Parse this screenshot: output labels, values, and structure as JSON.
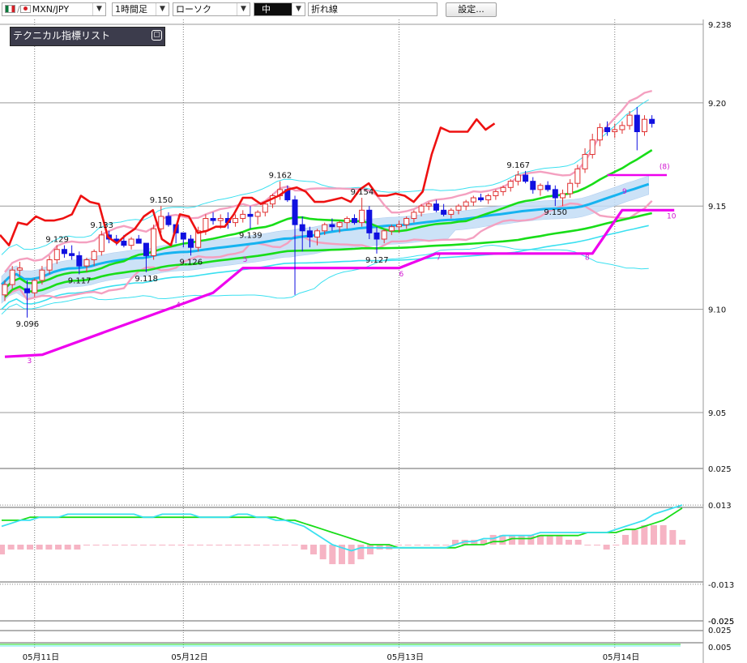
{
  "toolbar": {
    "pair": "MXN/JPY",
    "timeframe": "1時間足",
    "chart_type": "ローソク",
    "size": "中",
    "overlay": "折れ線",
    "settings_label": "設定..."
  },
  "legend": {
    "title": "テクニカル指標リスト",
    "minimize_glyph": "▢"
  },
  "colors": {
    "up_candle": "#e03030",
    "down_candle": "#1010e0",
    "red_line": "#ee1111",
    "pink_band": "#f4a0c0",
    "green_line": "#18dd18",
    "blue_line": "#16b3f0",
    "cloud": "#c4ddf6",
    "cyan_band": "#3ae0f0",
    "magenta_line": "#ee00ee",
    "macd_hist": "#f6b4c4"
  },
  "chart_data": [
    {
      "type": "candlestick",
      "x_labels": [
        "05月11日",
        "05月12日",
        "05月13日",
        "05月14日"
      ],
      "y_ticks": [
        "9.238",
        "9.20",
        "9.15",
        "9.10",
        "9.05"
      ],
      "ylim": [
        9.03,
        9.238
      ],
      "candles": [
        [
          9.107,
          9.114,
          9.104,
          9.112
        ],
        [
          9.112,
          9.121,
          9.11,
          9.119
        ],
        [
          9.119,
          9.123,
          9.116,
          9.12
        ],
        [
          9.11,
          9.114,
          9.096,
          9.108
        ],
        [
          9.108,
          9.115,
          9.106,
          9.114
        ],
        [
          9.114,
          9.121,
          9.112,
          9.119
        ],
        [
          9.119,
          9.126,
          9.117,
          9.124
        ],
        [
          9.124,
          9.131,
          9.122,
          9.129
        ],
        [
          9.129,
          9.131,
          9.125,
          9.127
        ],
        [
          9.127,
          9.131,
          9.124,
          9.126
        ],
        [
          9.126,
          9.128,
          9.117,
          9.121
        ],
        [
          9.121,
          9.125,
          9.118,
          9.124
        ],
        [
          9.124,
          9.129,
          9.121,
          9.128
        ],
        [
          9.128,
          9.138,
          9.126,
          9.136
        ],
        [
          9.136,
          9.138,
          9.132,
          9.134
        ],
        [
          9.134,
          9.136,
          9.131,
          9.133
        ],
        [
          9.133,
          9.136,
          9.13,
          9.131
        ],
        [
          9.131,
          9.135,
          9.129,
          9.134
        ],
        [
          9.134,
          9.136,
          9.132,
          9.132
        ],
        [
          9.132,
          9.132,
          9.118,
          9.126
        ],
        [
          9.126,
          9.141,
          9.124,
          9.139
        ],
        [
          9.139,
          9.15,
          9.137,
          9.145
        ],
        [
          9.145,
          9.147,
          9.14,
          9.141
        ],
        [
          9.141,
          9.141,
          9.132,
          9.137
        ],
        [
          9.137,
          9.137,
          9.13,
          9.134
        ],
        [
          9.134,
          9.136,
          9.126,
          9.13
        ],
        [
          9.13,
          9.14,
          9.128,
          9.138
        ],
        [
          9.138,
          9.146,
          9.136,
          9.144
        ],
        [
          9.144,
          9.147,
          9.141,
          9.143
        ],
        [
          9.143,
          9.146,
          9.139,
          9.144
        ],
        [
          9.144,
          9.147,
          9.139,
          9.142
        ],
        [
          9.142,
          9.146,
          9.14,
          9.144
        ],
        [
          9.144,
          9.148,
          9.142,
          9.146
        ],
        [
          9.146,
          9.15,
          9.139,
          9.145
        ],
        [
          9.145,
          9.148,
          9.141,
          9.147
        ],
        [
          9.147,
          9.152,
          9.145,
          9.151
        ],
        [
          9.151,
          9.156,
          9.149,
          9.155
        ],
        [
          9.155,
          9.162,
          9.153,
          9.158
        ],
        [
          9.158,
          9.16,
          9.152,
          9.153
        ],
        [
          9.153,
          9.155,
          9.107,
          9.141
        ],
        [
          9.141,
          9.145,
          9.128,
          9.138
        ],
        [
          9.138,
          9.14,
          9.13,
          9.135
        ],
        [
          9.135,
          9.139,
          9.131,
          9.138
        ],
        [
          9.138,
          9.142,
          9.136,
          9.141
        ],
        [
          9.141,
          9.144,
          9.138,
          9.14
        ],
        [
          9.14,
          9.143,
          9.137,
          9.142
        ],
        [
          9.142,
          9.145,
          9.139,
          9.144
        ],
        [
          9.144,
          9.146,
          9.141,
          9.142
        ],
        [
          9.142,
          9.154,
          9.14,
          9.148
        ],
        [
          9.148,
          9.15,
          9.134,
          9.137
        ],
        [
          9.137,
          9.14,
          9.127,
          9.134
        ],
        [
          9.134,
          9.139,
          9.132,
          9.138
        ],
        [
          9.138,
          9.141,
          9.136,
          9.14
        ],
        [
          9.14,
          9.143,
          9.137,
          9.141
        ],
        [
          9.141,
          9.145,
          9.139,
          9.144
        ],
        [
          9.144,
          9.148,
          9.142,
          9.147
        ],
        [
          9.147,
          9.151,
          9.145,
          9.15
        ],
        [
          9.15,
          9.152,
          9.148,
          9.151
        ],
        [
          9.151,
          9.153,
          9.147,
          9.148
        ],
        [
          9.148,
          9.151,
          9.145,
          9.146
        ],
        [
          9.146,
          9.149,
          9.144,
          9.148
        ],
        [
          9.148,
          9.151,
          9.146,
          9.15
        ],
        [
          9.15,
          9.153,
          9.148,
          9.152
        ],
        [
          9.152,
          9.155,
          9.15,
          9.154
        ],
        [
          9.154,
          9.156,
          9.152,
          9.153
        ],
        [
          9.153,
          9.156,
          9.151,
          9.155
        ],
        [
          9.155,
          9.158,
          9.153,
          9.157
        ],
        [
          9.157,
          9.16,
          9.155,
          9.159
        ],
        [
          9.159,
          9.163,
          9.157,
          9.162
        ],
        [
          9.162,
          9.167,
          9.16,
          9.165
        ],
        [
          9.165,
          9.167,
          9.161,
          9.162
        ],
        [
          9.162,
          9.164,
          9.156,
          9.158
        ],
        [
          9.158,
          9.161,
          9.155,
          9.16
        ],
        [
          9.16,
          9.162,
          9.157,
          9.158
        ],
        [
          9.158,
          9.16,
          9.15,
          9.154
        ],
        [
          9.154,
          9.158,
          9.15,
          9.156
        ],
        [
          9.156,
          9.163,
          9.154,
          9.161
        ],
        [
          9.161,
          9.17,
          9.159,
          9.168
        ],
        [
          9.168,
          9.178,
          9.166,
          9.175
        ],
        [
          9.175,
          9.185,
          9.173,
          9.182
        ],
        [
          9.182,
          9.19,
          9.179,
          9.188
        ],
        [
          9.188,
          9.191,
          9.184,
          9.186
        ],
        [
          9.186,
          9.19,
          9.183,
          9.187
        ],
        [
          9.187,
          9.191,
          9.185,
          9.189
        ],
        [
          9.189,
          9.196,
          9.187,
          9.194
        ],
        [
          9.194,
          9.198,
          9.177,
          9.186
        ],
        [
          9.186,
          9.194,
          9.184,
          9.192
        ],
        [
          9.192,
          9.194,
          9.188,
          9.19
        ]
      ],
      "annotations": [
        {
          "label": "9.096",
          "bar": 3
        },
        {
          "label": "9.129",
          "bar": 7
        },
        {
          "label": "9.117",
          "bar": 10
        },
        {
          "label": "9.133",
          "bar": 13
        },
        {
          "label": "9.118",
          "bar": 19
        },
        {
          "label": "9.150",
          "bar": 21
        },
        {
          "label": "9.126",
          "bar": 25
        },
        {
          "label": "9.139",
          "bar": 33
        },
        {
          "label": "9.162",
          "bar": 37
        },
        {
          "label": "9.154",
          "bar": 48
        },
        {
          "label": "9.127",
          "bar": 50
        },
        {
          "label": "9.167",
          "bar": 69
        },
        {
          "label": "9.150",
          "bar": 74
        }
      ],
      "red_line": [
        [
          0,
          9.136
        ],
        [
          2,
          9.131
        ],
        [
          4,
          9.142
        ],
        [
          6,
          9.141
        ],
        [
          8,
          9.145
        ],
        [
          10,
          9.143
        ],
        [
          12,
          9.143
        ],
        [
          14,
          9.144
        ],
        [
          16,
          9.146
        ],
        [
          18,
          9.155
        ],
        [
          20,
          9.152
        ],
        [
          22,
          9.151
        ],
        [
          24,
          9.135
        ],
        [
          26,
          9.132
        ],
        [
          28,
          9.136
        ],
        [
          30,
          9.139
        ],
        [
          32,
          9.145
        ],
        [
          34,
          9.148
        ],
        [
          36,
          9.134
        ],
        [
          38,
          9.131
        ],
        [
          40,
          9.146
        ],
        [
          42,
          9.145
        ],
        [
          44,
          9.137
        ],
        [
          46,
          9.138
        ],
        [
          48,
          9.14
        ],
        [
          50,
          9.14
        ],
        [
          52,
          9.146
        ],
        [
          54,
          9.154
        ],
        [
          56,
          9.154
        ],
        [
          58,
          9.151
        ],
        [
          60,
          9.153
        ],
        [
          62,
          9.155
        ],
        [
          64,
          9.158
        ],
        [
          66,
          9.159
        ],
        [
          68,
          9.157
        ],
        [
          70,
          9.152
        ],
        [
          72,
          9.152
        ],
        [
          74,
          9.153
        ],
        [
          76,
          9.154
        ],
        [
          78,
          9.152
        ],
        [
          80,
          9.158
        ],
        [
          82,
          9.161
        ],
        [
          84,
          9.155
        ],
        [
          86,
          9.155
        ],
        [
          88,
          9.156
        ],
        [
          90,
          9.155
        ],
        [
          92,
          9.152
        ],
        [
          94,
          9.157
        ],
        [
          96,
          9.175
        ],
        [
          98,
          9.188
        ],
        [
          100,
          9.186
        ],
        [
          102,
          9.186
        ],
        [
          104,
          9.186
        ],
        [
          106,
          9.192
        ],
        [
          108,
          9.187
        ],
        [
          110,
          9.19
        ]
      ],
      "cloud_label": ""
    },
    {
      "type": "line",
      "name": "",
      "y_ticks": [
        "0.025",
        "0.013",
        "-0.013",
        "-0.025"
      ],
      "ylim": [
        -0.025,
        0.025
      ],
      "macd": [
        0.006,
        0.007,
        0.008,
        0.008,
        0.009,
        0.009,
        0.009,
        0.01,
        0.01,
        0.01,
        0.01,
        0.01,
        0.01,
        0.01,
        0.01,
        0.009,
        0.009,
        0.01,
        0.01,
        0.01,
        0.01,
        0.009,
        0.009,
        0.009,
        0.009,
        0.01,
        0.01,
        0.009,
        0.009,
        0.008,
        0.008,
        0.007,
        0.006,
        0.004,
        0.002,
        0.0,
        -0.001,
        -0.002,
        -0.001,
        -0.001,
        -0.001,
        -0.001,
        -0.001,
        -0.001,
        -0.001,
        -0.001,
        -0.001,
        -0.001,
        0.0,
        0.001,
        0.001,
        0.002,
        0.002,
        0.003,
        0.003,
        0.003,
        0.003,
        0.004,
        0.004,
        0.004,
        0.004,
        0.004,
        0.004,
        0.004,
        0.004,
        0.005,
        0.006,
        0.007,
        0.008,
        0.01,
        0.011,
        0.012,
        0.013
      ],
      "signal": [
        0.008,
        0.008,
        0.008,
        0.009,
        0.009,
        0.009,
        0.009,
        0.009,
        0.009,
        0.009,
        0.009,
        0.009,
        0.009,
        0.009,
        0.009,
        0.009,
        0.009,
        0.009,
        0.009,
        0.009,
        0.009,
        0.009,
        0.009,
        0.009,
        0.009,
        0.009,
        0.009,
        0.009,
        0.009,
        0.009,
        0.008,
        0.008,
        0.007,
        0.006,
        0.005,
        0.004,
        0.003,
        0.002,
        0.001,
        0.0,
        0.0,
        -0.0,
        -0.001,
        -0.001,
        -0.001,
        -0.001,
        -0.001,
        -0.001,
        -0.001,
        -0.0,
        0.0,
        0.0,
        0.001,
        0.001,
        0.002,
        0.002,
        0.002,
        0.003,
        0.003,
        0.003,
        0.003,
        0.003,
        0.004,
        0.004,
        0.004,
        0.004,
        0.005,
        0.005,
        0.006,
        0.007,
        0.008,
        0.01,
        0.012
      ],
      "hist": [
        -0.002,
        -0.001,
        -0.001,
        -0.001,
        -0.001,
        -0.001,
        -0.001,
        -0.001,
        -0.001,
        -0.0,
        -0.0,
        -0.0,
        -0.0,
        0.0,
        0.0,
        0.0,
        0.0,
        0.0,
        0.0,
        0.0,
        0.0,
        0.0,
        -0.0,
        -0.0,
        -0.0,
        0.0,
        0.0,
        0.0,
        0.0,
        0.0,
        -0.0,
        -0.0,
        -0.001,
        -0.002,
        -0.003,
        -0.004,
        -0.004,
        -0.004,
        -0.003,
        -0.002,
        -0.001,
        -0.001,
        -0.0,
        0.0,
        0.0,
        0.0,
        0.0,
        0.0,
        0.001,
        0.001,
        0.001,
        0.001,
        0.002,
        0.002,
        0.002,
        0.002,
        0.002,
        0.002,
        0.002,
        0.002,
        0.001,
        0.001,
        -0.0,
        -0.0,
        -0.001,
        0.0,
        0.002,
        0.003,
        0.004,
        0.004,
        0.004,
        0.003,
        0.001
      ]
    },
    {
      "type": "line",
      "name": "",
      "y_ticks": [
        "-0.025",
        "0.025",
        "0.005"
      ],
      "ylim": [
        -0.025,
        0.025
      ]
    }
  ],
  "trend_labels": [
    "3",
    "4",
    "5",
    "6",
    "7",
    "8",
    "9",
    "10",
    "(8)"
  ]
}
